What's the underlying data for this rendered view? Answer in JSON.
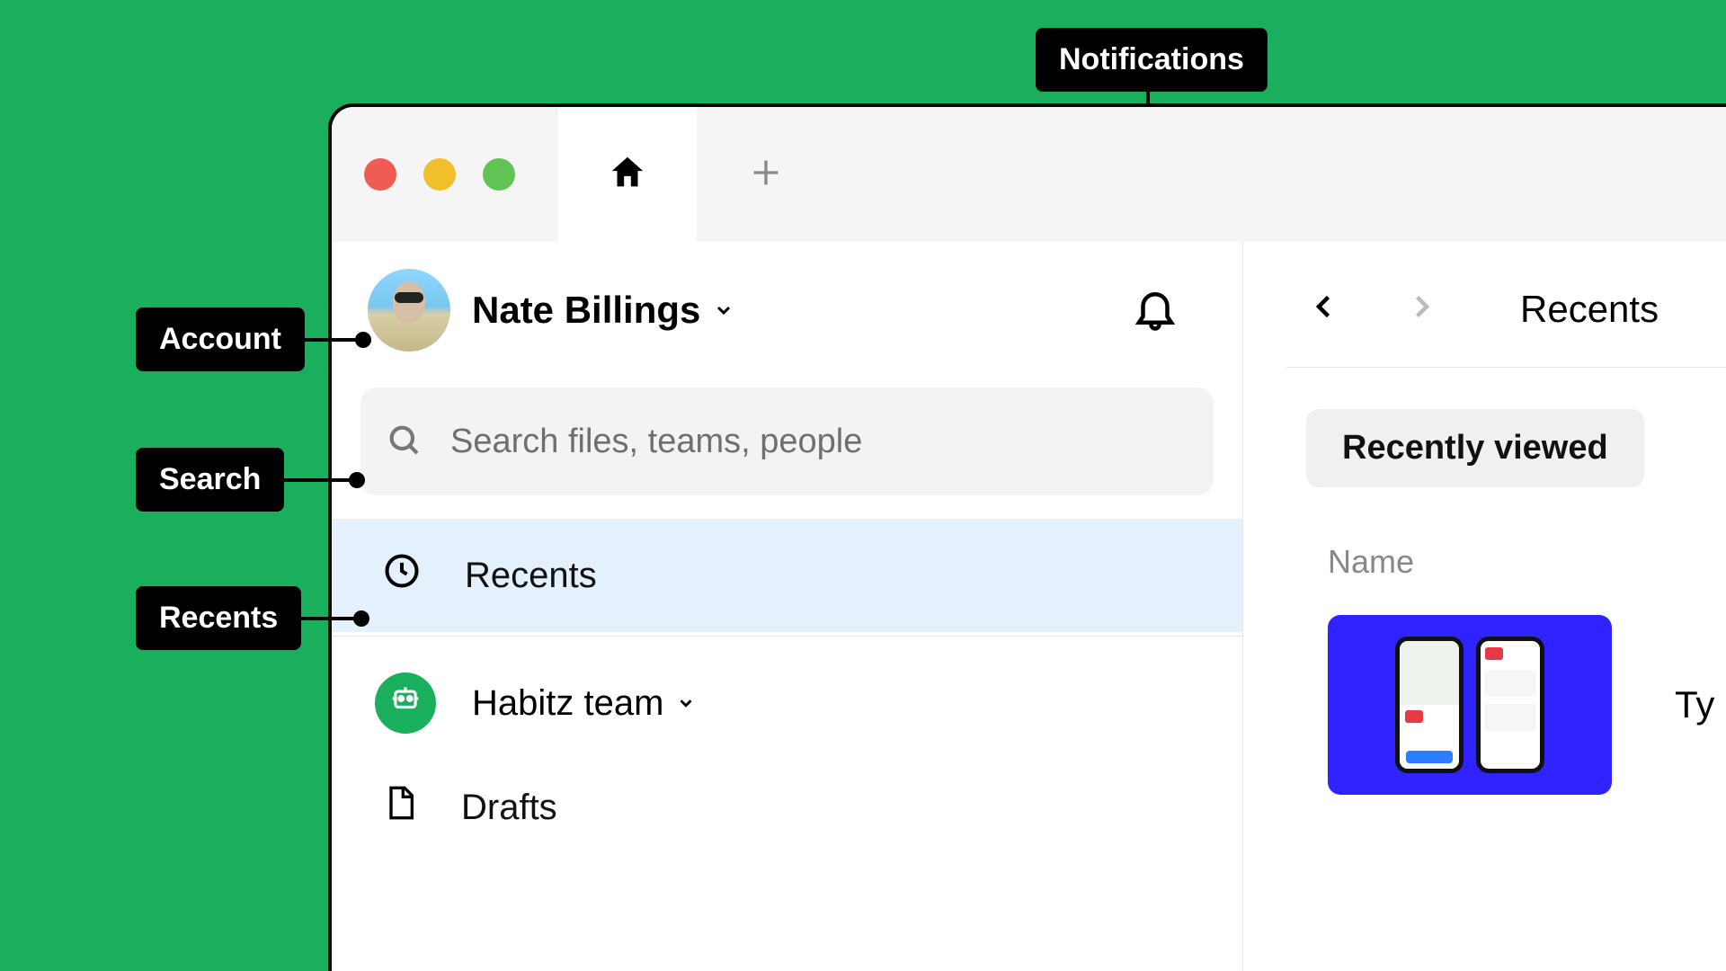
{
  "callouts": {
    "notifications": "Notifications",
    "account": "Account",
    "search": "Search",
    "recents": "Recents"
  },
  "account": {
    "name": "Nate Billings"
  },
  "search": {
    "placeholder": "Search files, teams, people"
  },
  "sidebar": {
    "recents": "Recents",
    "drafts": "Drafts"
  },
  "team": {
    "name": "Habitz team"
  },
  "main": {
    "title": "Recents",
    "filter_pill": "Recently viewed",
    "column_header": "Name",
    "file_label": "Ty"
  }
}
